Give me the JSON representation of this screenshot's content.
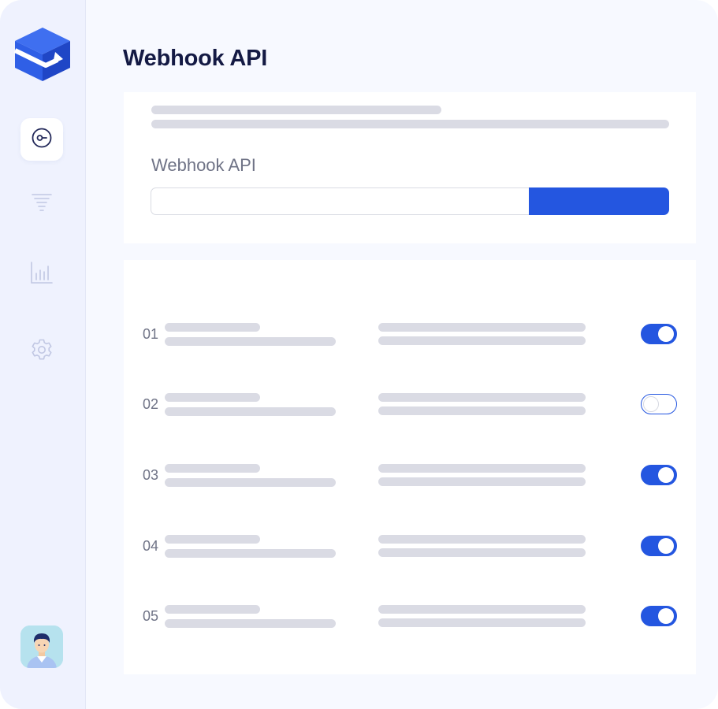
{
  "app": {
    "logo_icon": "box-arrow-logo-icon",
    "brand_color": "#2456e0"
  },
  "sidebar": {
    "items": [
      {
        "icon": "webhook-icon",
        "active": true
      },
      {
        "icon": "filter-icon",
        "active": false
      },
      {
        "icon": "bar-chart-icon",
        "active": false
      },
      {
        "icon": "gear-icon",
        "active": false
      }
    ],
    "avatar_icon": "user-avatar"
  },
  "page": {
    "title": "Webhook API"
  },
  "form": {
    "label": "Webhook API",
    "input_value": "",
    "input_placeholder": "",
    "button_label": ""
  },
  "list": {
    "rows": [
      {
        "num": "01",
        "enabled": true
      },
      {
        "num": "02",
        "enabled": false
      },
      {
        "num": "03",
        "enabled": true
      },
      {
        "num": "04",
        "enabled": true
      },
      {
        "num": "05",
        "enabled": true
      }
    ]
  }
}
